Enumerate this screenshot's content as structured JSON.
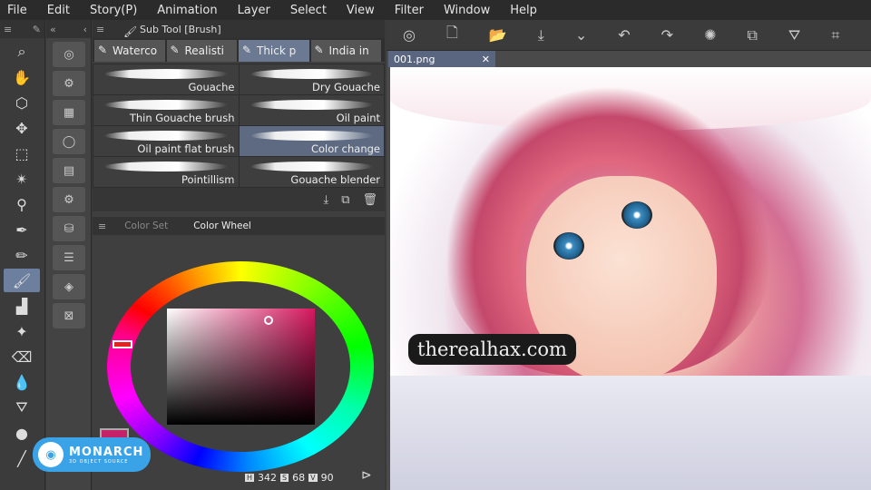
{
  "menu": [
    "File",
    "Edit",
    "Story(P)",
    "Animation",
    "Layer",
    "Select",
    "View",
    "Filter",
    "Window",
    "Help"
  ],
  "subtool": {
    "title": "Sub Tool [Brush]",
    "tabs": [
      "Waterco",
      "Realisti",
      "Thick p",
      "India in"
    ],
    "active_tab": 2,
    "brushes": [
      "Gouache",
      "Dry Gouache",
      "Thin Gouache brush",
      "Oil paint",
      "Oil paint flat brush",
      "Color change",
      "Pointillism",
      "Gouache blender"
    ],
    "selected_brush": 5
  },
  "color_panel": {
    "tabs": [
      "Color Set",
      "Color Wheel"
    ],
    "active_tab": 1,
    "h": "342",
    "s": "68",
    "v": "90",
    "h_label": "H",
    "s_label": "S",
    "v_label": "V",
    "current_color": "#c4236a"
  },
  "document": {
    "tab": "001.png"
  },
  "watermark": "therealhax.com",
  "logo": {
    "name": "MONARCH",
    "sub": "3D OBJECT SOURCE"
  }
}
